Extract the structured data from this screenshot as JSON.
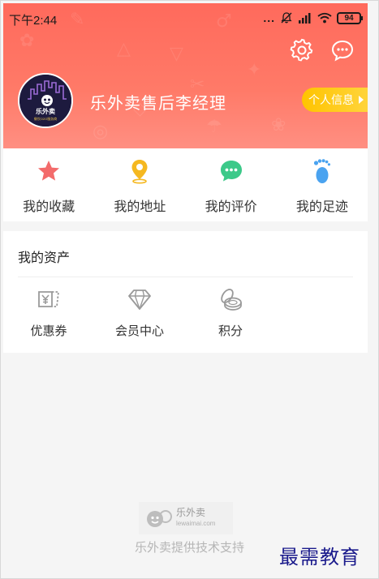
{
  "status_bar": {
    "time": "下午2:44",
    "more": "...",
    "battery": "94"
  },
  "header": {
    "username": "乐外卖售后李经理",
    "profile_button": "个人信息",
    "avatar": {
      "brand": "乐外卖",
      "tagline": "餐饮O2O服务商"
    },
    "colors": {
      "header_start": "#ff6a5c",
      "header_end": "#ff8f82",
      "pill": "#ffc400"
    },
    "actions": [
      {
        "icon": "gear-icon"
      },
      {
        "icon": "chat-bubble-icon"
      }
    ]
  },
  "quick_menu": [
    {
      "label": "我的收藏",
      "icon": "star-icon",
      "color": "#f36b6b"
    },
    {
      "label": "我的地址",
      "icon": "location-pin-icon",
      "color": "#f5b820"
    },
    {
      "label": "我的评价",
      "icon": "comment-icon",
      "color": "#3cc989"
    },
    {
      "label": "我的足迹",
      "icon": "footprint-icon",
      "color": "#4aa3f0"
    }
  ],
  "assets": {
    "title": "我的资产",
    "items": [
      {
        "label": "优惠券",
        "icon": "coupon-icon"
      },
      {
        "label": "会员中心",
        "icon": "diamond-icon"
      },
      {
        "label": "积分",
        "icon": "coins-icon"
      }
    ]
  },
  "footer": {
    "logo_name": "乐外卖",
    "logo_domain": "lewaimai.com",
    "support_text": "乐外卖提供技术支持"
  },
  "watermark": "最需教育"
}
